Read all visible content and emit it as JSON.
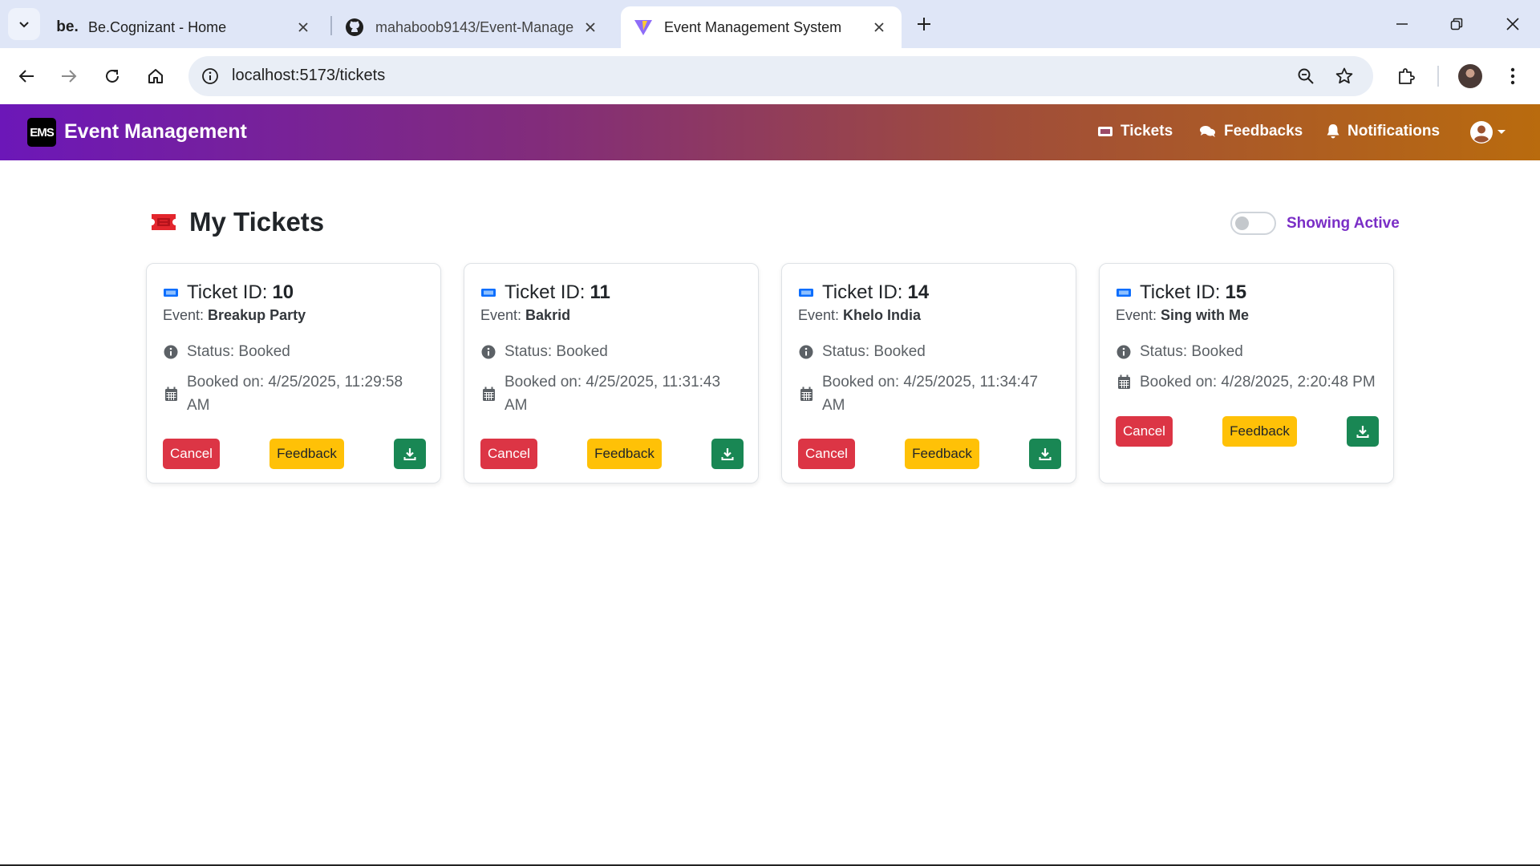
{
  "browser": {
    "tabs": [
      {
        "favicon": "be.",
        "title": "Be.Cognizant - Home"
      },
      {
        "favicon": "github-icon",
        "title": "mahaboob9143/Event-Manage"
      },
      {
        "favicon": "vite-icon",
        "title": "Event Management System"
      }
    ],
    "url": "localhost:5173/tickets"
  },
  "app": {
    "logo_text": "EMS",
    "brand": "Event Management",
    "nav": {
      "tickets": "Tickets",
      "feedbacks": "Feedbacks",
      "notifications": "Notifications"
    }
  },
  "page": {
    "title": "My Tickets",
    "toggle_label": "Showing Active",
    "toggle_on": false
  },
  "tickets": [
    {
      "id_label": "Ticket ID:",
      "id": "10",
      "event_label": "Event:",
      "event": "Breakup Party",
      "status": "Status: Booked",
      "booked": "Booked on: 4/25/2025, 11:29:58 AM",
      "cancel": "Cancel",
      "feedback": "Feedback"
    },
    {
      "id_label": "Ticket ID:",
      "id": "11",
      "event_label": "Event:",
      "event": "Bakrid",
      "status": "Status: Booked",
      "booked": "Booked on: 4/25/2025, 11:31:43 AM",
      "cancel": "Cancel",
      "feedback": "Feedback"
    },
    {
      "id_label": "Ticket ID:",
      "id": "14",
      "event_label": "Event:",
      "event": "Khelo India",
      "status": "Status: Booked",
      "booked": "Booked on: 4/25/2025, 11:34:47 AM",
      "cancel": "Cancel",
      "feedback": "Feedback"
    },
    {
      "id_label": "Ticket ID:",
      "id": "15",
      "event_label": "Event:",
      "event": "Sing with Me",
      "status": "Status: Booked",
      "booked": "Booked on: 4/28/2025, 2:20:48 PM",
      "cancel": "Cancel",
      "feedback": "Feedback"
    }
  ],
  "colors": {
    "nav_gradient_start": "#6c17b8",
    "nav_gradient_end": "#b96b0e",
    "cancel": "#dc3545",
    "feedback": "#ffc107",
    "download": "#198754",
    "ticket_icon": "#0d6efd",
    "toggle_label": "#7a2ec6"
  }
}
